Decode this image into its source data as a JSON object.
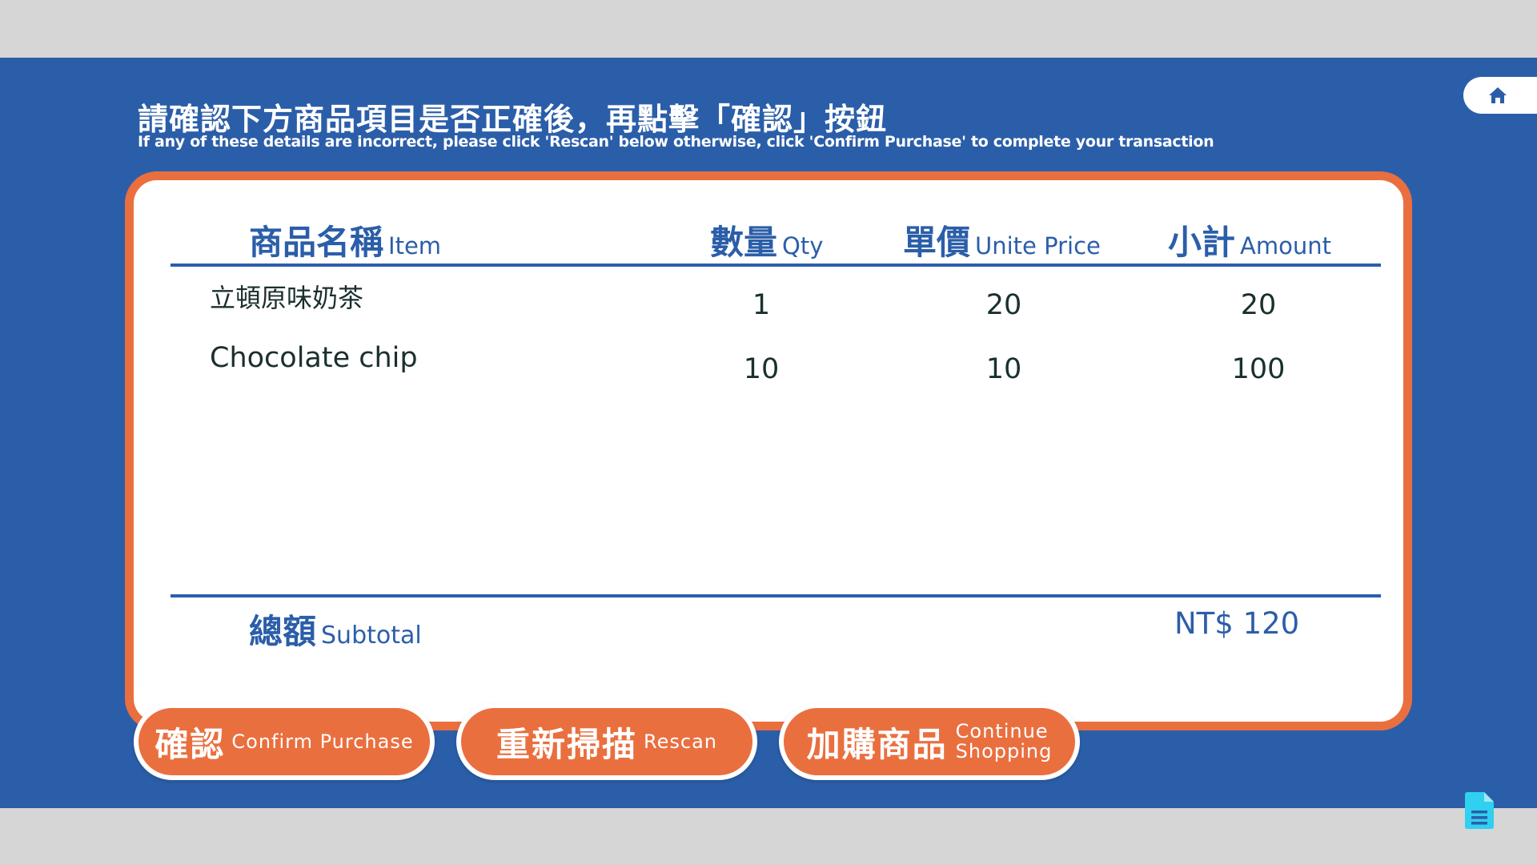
{
  "header": {
    "title": "請確認下方商品項目是否正確後，再點擊「確認」按鈕",
    "subtitle": "If any of these details are incorrect, please click 'Rescan' below otherwise, click 'Confirm Purchase' to complete your transaction"
  },
  "table": {
    "columns": [
      {
        "zh": "商品名稱",
        "en": "Item"
      },
      {
        "zh": "數量",
        "en": "Qty"
      },
      {
        "zh": "單價",
        "en": "Unite Price"
      },
      {
        "zh": "小計",
        "en": "Amount"
      }
    ],
    "rows": [
      {
        "item": "立頓原味奶茶",
        "qty": "1",
        "price": "20",
        "amount": "20"
      },
      {
        "item": "Chocolate chip",
        "qty": "10",
        "price": "10",
        "amount": "100"
      }
    ],
    "subtotal": {
      "zh": "總額",
      "en": "Subtotal",
      "value": "NT$ 120"
    }
  },
  "buttons": {
    "confirm": {
      "zh": "確認",
      "en": "Confirm Purchase"
    },
    "rescan": {
      "zh": "重新掃描",
      "en": "Rescan"
    },
    "continue": {
      "zh": "加購商品",
      "en_line1": "Continue",
      "en_line2": "Shopping"
    }
  },
  "icons": {
    "home": "home-icon",
    "document": "document-icon"
  },
  "colors": {
    "background": "#2b5ea9",
    "accent": "#ea6f3f",
    "panel": "#ffffff",
    "page_margin": "#d6d6d6",
    "doc_icon": "#2fd0f0"
  }
}
